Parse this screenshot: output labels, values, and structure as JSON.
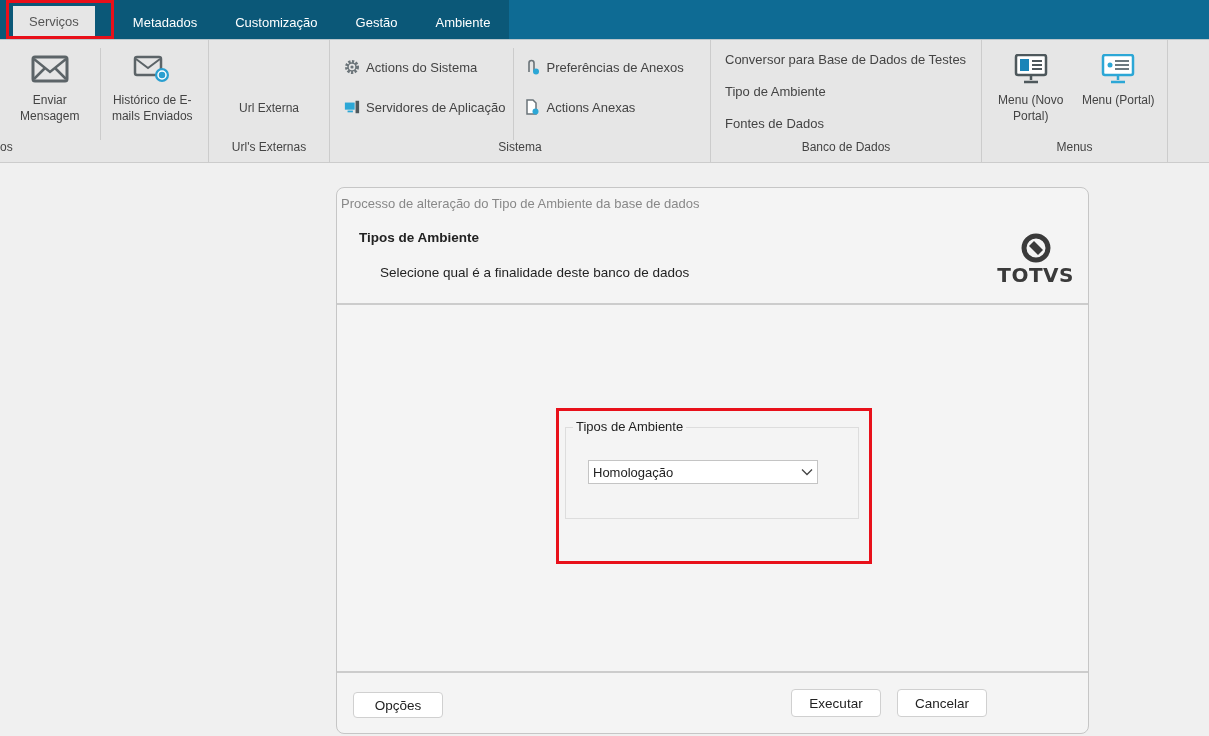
{
  "tabs": [
    {
      "label": "Serviços",
      "selected": true,
      "highlighted": true
    },
    {
      "label": "Metadados",
      "selected": false,
      "highlighted": false
    },
    {
      "label": "Customização",
      "selected": false,
      "highlighted": false
    },
    {
      "label": "Gestão",
      "selected": false,
      "highlighted": false
    },
    {
      "label": "Ambiente",
      "selected": false,
      "highlighted": false
    }
  ],
  "ribbon": {
    "groups": [
      {
        "label": "os",
        "kind": "large",
        "items": [
          {
            "label": "Enviar Mensagem"
          },
          {
            "label": "Histórico de E-mails Enviados"
          }
        ]
      },
      {
        "label": "Url's Externas",
        "kind": "large",
        "items": [
          {
            "label": "Url Externa"
          }
        ]
      },
      {
        "label": "Sistema",
        "kind": "small",
        "columns": [
          [
            {
              "label": "Actions do Sistema"
            },
            {
              "label": "Servidores de Aplicação"
            }
          ],
          [
            {
              "label": "Preferências de Anexos"
            },
            {
              "label": "Actions Anexas"
            }
          ]
        ]
      },
      {
        "label": "Banco de Dados",
        "kind": "small",
        "columns": [
          [
            {
              "label": "Conversor para Base de Dados de Testes"
            },
            {
              "label": "Tipo de Ambiente"
            },
            {
              "label": "Fontes de Dados"
            }
          ]
        ]
      },
      {
        "label": "Menus",
        "kind": "large",
        "items": [
          {
            "label": "Menu (Novo Portal)"
          },
          {
            "label": "Menu (Portal)"
          }
        ]
      }
    ]
  },
  "dialog": {
    "title": "Processo de alteração do Tipo de Ambiente da base de dados",
    "heading": "Tipos de Ambiente",
    "subtitle": "Selecione qual é a finalidade deste banco de dados",
    "logo": "TOTVS",
    "group": {
      "legend": "Tipos de Ambiente",
      "highlighted": true,
      "select": {
        "value": "Homologação"
      }
    },
    "buttons_left": [
      "Opções"
    ],
    "buttons_right": [
      "Executar",
      "Cancelar"
    ]
  }
}
